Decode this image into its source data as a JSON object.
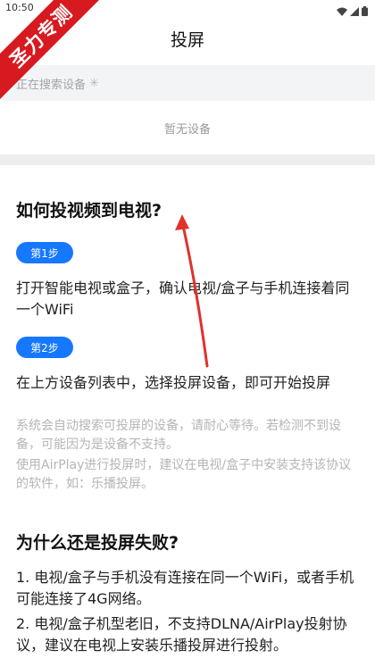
{
  "status_bar": {
    "time": "10:50",
    "icons": [
      "wifi-icon",
      "signal-icon",
      "battery-icon"
    ]
  },
  "watermark": {
    "text": "圣力专测",
    "color": "#d71920"
  },
  "header": {
    "title": "投屏"
  },
  "device_search": {
    "status_text": "正在搜索设备",
    "spinner_icon": "spinner-icon",
    "empty_text": "暂无设备"
  },
  "guide": {
    "title": "如何投视频到电视?",
    "steps": [
      {
        "badge": "第1步",
        "text": "打开智能电视或盒子，确认电视/盒子与手机连接着同一个WiFi"
      },
      {
        "badge": "第2步",
        "text": "在上方设备列表中，选择投屏设备，即可开始投屏"
      }
    ],
    "hints": [
      "系统会自动搜索可投屏的设备，请耐心等待。若检测不到设备，可能因为是设备不支持。",
      "使用AirPlay进行投屏时，建议在电视/盒子中安装支持该协议的软件，如：乐播投屏。"
    ]
  },
  "failure": {
    "title": "为什么还是投屏失败?",
    "reasons": [
      "1. 电视/盒子与手机没有连接在同一个WiFi，或者手机可能连接了4G网络。",
      "2. 电视/盒子机型老旧，不支持DLNA/AirPlay投射协议，建议在电视上安装乐播投屏进行投射。"
    ]
  },
  "colors": {
    "accent": "#1677ff",
    "annotation_arrow": "#e0312b"
  }
}
